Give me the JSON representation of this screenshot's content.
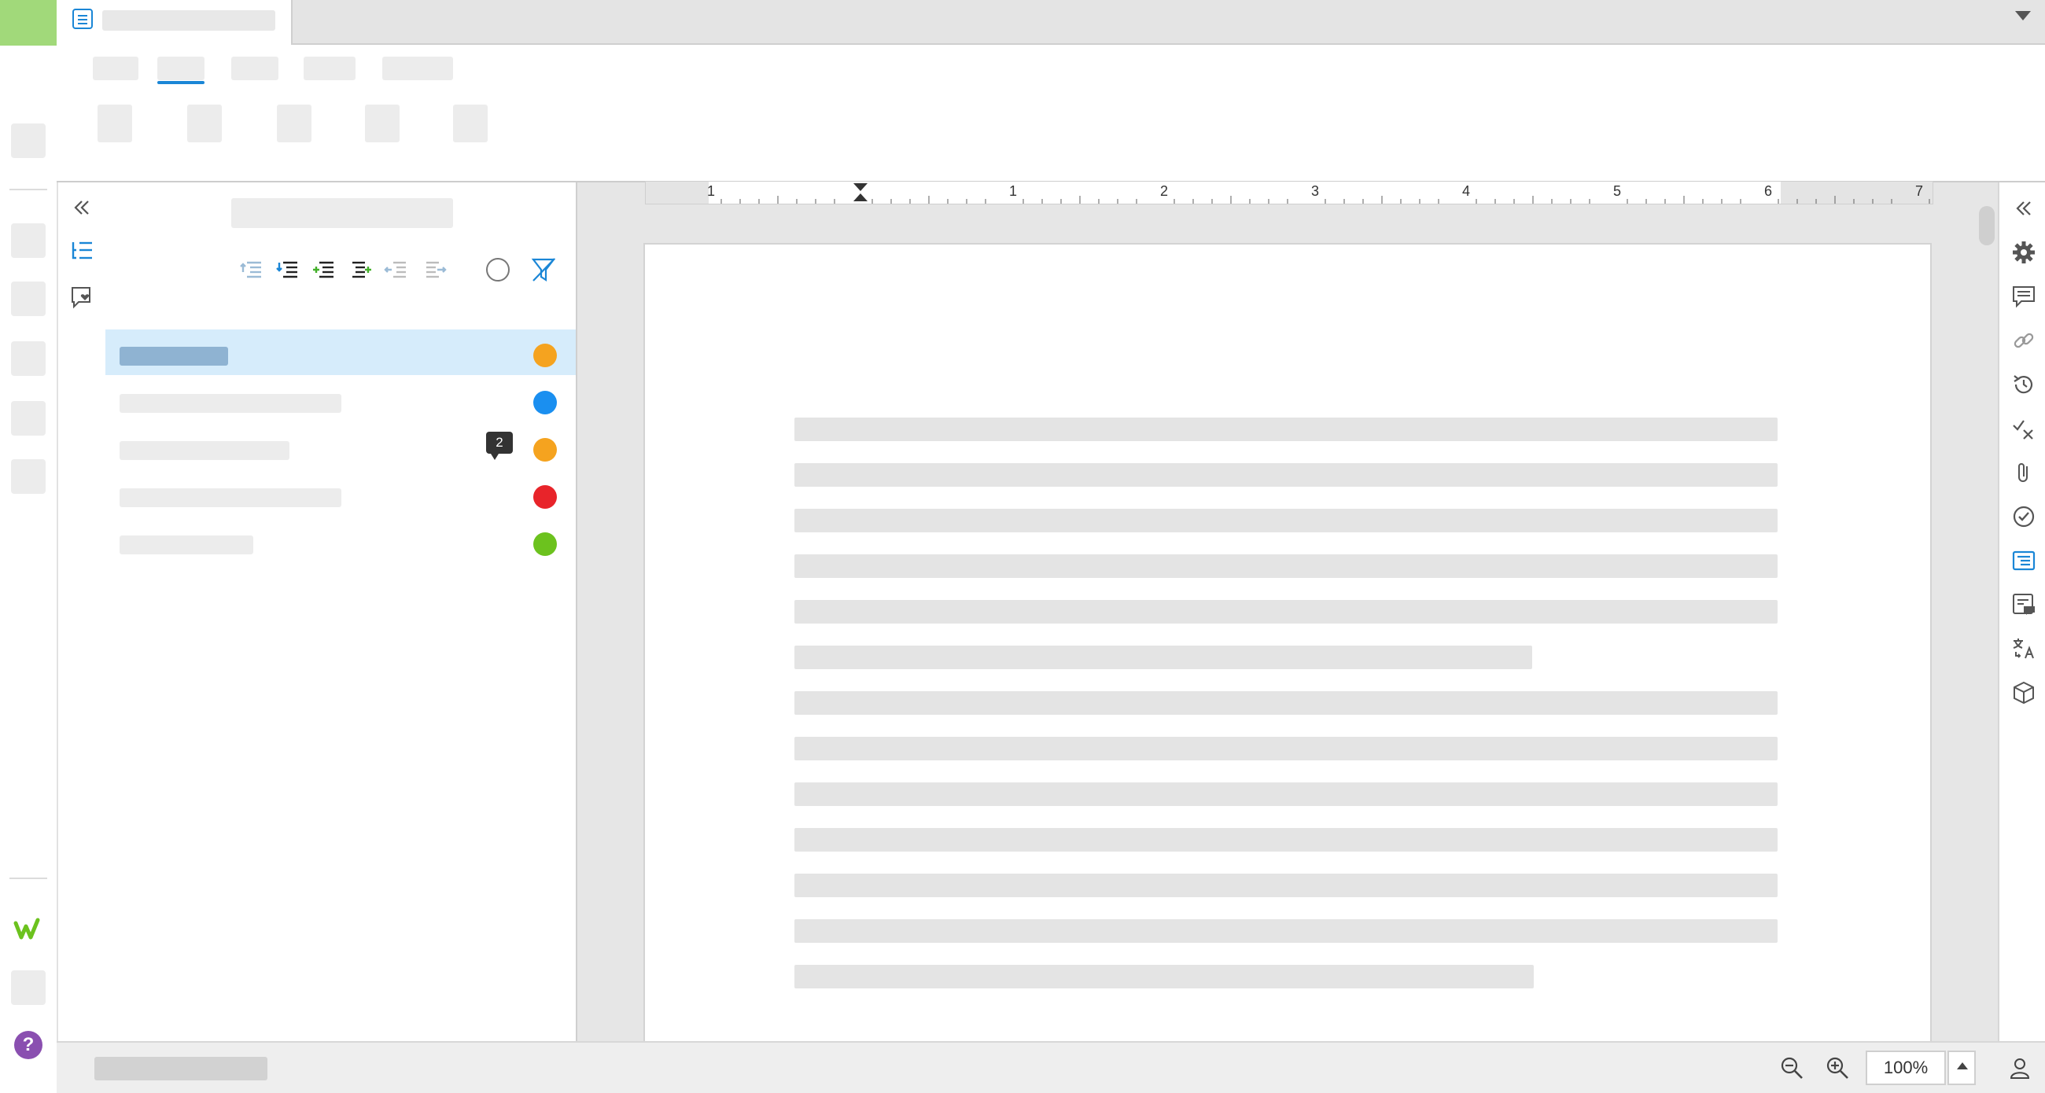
{
  "app": {
    "help_label": "?"
  },
  "outline": {
    "items": [
      {
        "status": "orange",
        "selected": true
      },
      {
        "status": "blue",
        "selected": false
      },
      {
        "status": "orange",
        "selected": false,
        "comment_count": "2"
      },
      {
        "status": "red",
        "selected": false
      },
      {
        "status": "green",
        "selected": false
      }
    ]
  },
  "ruler": {
    "labels": [
      "1",
      "1",
      "2",
      "3",
      "4",
      "5",
      "6",
      "7"
    ]
  },
  "statusbar": {
    "zoom": "100%"
  },
  "colors": {
    "accent": "#1a86d6",
    "orange": "#f5a31f",
    "blue": "#1a8ff0",
    "red": "#e8242a",
    "green": "#6cc21e",
    "brand_green": "#a1d97a",
    "help": "#8a4fb0"
  }
}
